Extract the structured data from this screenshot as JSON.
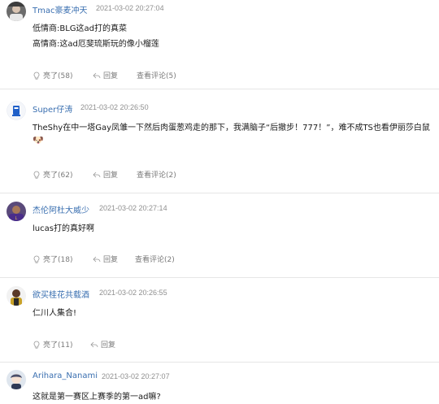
{
  "comments": [
    {
      "username": "Tmac豪麦冲天",
      "time": "2021-03-02 20:27:04",
      "lines": [
        "低情商:BLG这ad打的真菜",
        "高情商:这ad厄斐琉斯玩的像小榴莲"
      ],
      "like_label": "亮了(58)",
      "reply_label": "回复",
      "view_label": "查看评论(5)",
      "avatar": "player-avatar-dark"
    },
    {
      "username": "Super仔涛",
      "time": "2021-03-02 20:26:50",
      "lines": [
        "TheShy在中一塔Gay凤雏一下然后肉蛋葱鸡走的那下，我满脑子“后撤步！777！”，难不成TS也看伊丽莎白鼠"
      ],
      "emoji": "🐶",
      "like_label": "亮了(62)",
      "reply_label": "回复",
      "view_label": "查看评论(2)",
      "avatar": "blue-trophy-avatar"
    },
    {
      "username": "杰伦阿杜大威少",
      "time": "2021-03-02 20:27:14",
      "lines": [
        "lucas打的真好啊"
      ],
      "like_label": "亮了(18)",
      "reply_label": "回复",
      "view_label": "查看评论(2)",
      "avatar": "player-avatar-purple"
    },
    {
      "username": "欲买桂花共载酒",
      "time": "2021-03-02 20:26:55",
      "lines": [
        "仁川人集合!"
      ],
      "like_label": "亮了(11)",
      "reply_label": "回复",
      "avatar": "player-avatar-light"
    },
    {
      "username": "Arihara_Nanami",
      "time": "2021-03-02 20:27:07",
      "lines": [
        "这就是第一赛区上赛季的第一ad嘛?"
      ],
      "avatar": "anime-avatar"
    }
  ]
}
